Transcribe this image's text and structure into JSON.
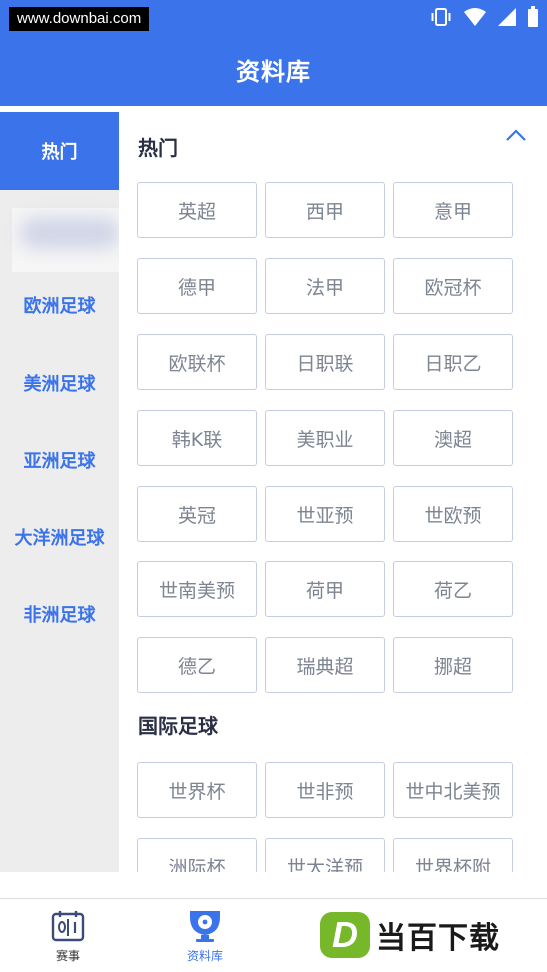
{
  "status_bar": {
    "watermark_url": "www.downbai.com"
  },
  "header": {
    "title": "资料库"
  },
  "sidebar": {
    "items": [
      {
        "label": "热门",
        "active": true
      },
      {
        "label": "",
        "blurred": true
      },
      {
        "label": "欧洲足球"
      },
      {
        "label": "美洲足球"
      },
      {
        "label": "亚洲足球"
      },
      {
        "label": "大洋洲足球"
      },
      {
        "label": "非洲足球"
      }
    ]
  },
  "sections": [
    {
      "title": "热门",
      "tags": [
        "英超",
        "西甲",
        "意甲",
        "德甲",
        "法甲",
        "欧冠杯",
        "欧联杯",
        "日职联",
        "日职乙",
        "韩K联",
        "美职业",
        "澳超",
        "英冠",
        "世亚预",
        "世欧预",
        "世南美预",
        "荷甲",
        "荷乙",
        "德乙",
        "瑞典超",
        "挪超"
      ]
    },
    {
      "title": "国际足球",
      "tags": [
        "世界杯",
        "世非预",
        "世中北美预",
        "洲际杯",
        "世大洋预",
        "世界杯附"
      ]
    }
  ],
  "bottom_nav": {
    "items": [
      {
        "label": "赛事",
        "icon": "scoreboard-icon"
      },
      {
        "label": "资料库",
        "icon": "trophy-ball-icon",
        "active": true
      }
    ]
  },
  "brand": {
    "badge": "D",
    "name": "当百下载"
  },
  "colors": {
    "primary": "#3a73ea",
    "sidebar_bg": "#ededed",
    "tag_border": "#c5cee0",
    "brand_green": "#76b82a"
  }
}
